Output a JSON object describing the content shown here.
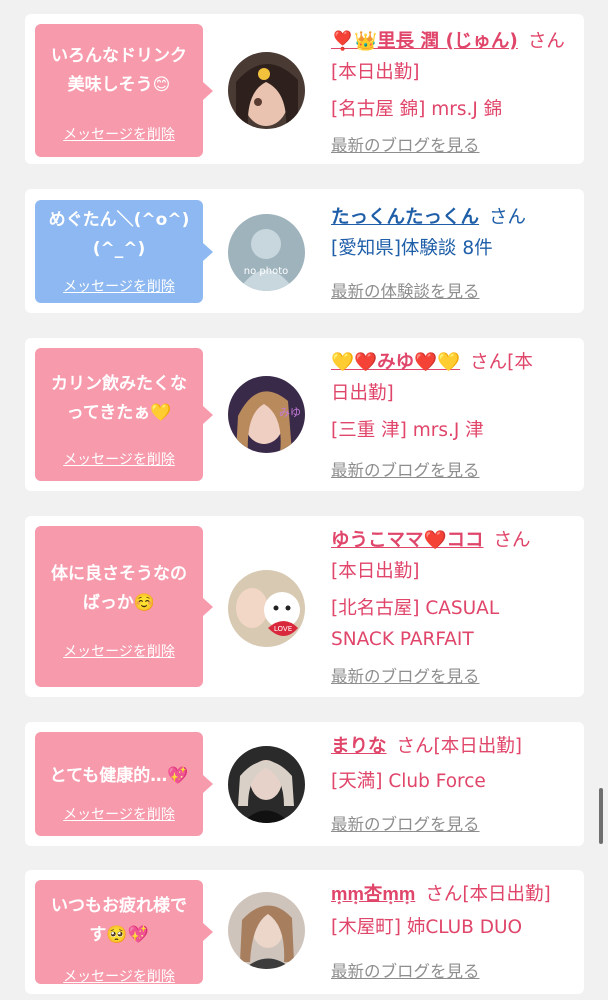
{
  "delete_label": "メッセージを削除",
  "cards": [
    {
      "message": "いろんなドリンク\n美味しそう😊",
      "name": "❣️👑里長 潤 (じゅん)",
      "san": "さん",
      "lines": [
        "[本日出勤]",
        "[名古屋 錦] mrs.J 錦"
      ],
      "link": "最新のブログを見る"
    },
    {
      "message": "めぐたん＼(^o^)\n(^_^)",
      "name": "たっくんたっくん",
      "san": "さん",
      "lines": [
        "[愛知県]体験談 8件"
      ],
      "link": "最新の体験談を見る",
      "avatar_text": "no photo"
    },
    {
      "message": "カリン飲みたくな\nってきたぁ💛",
      "name": "💛❤️みゆ❤️💛",
      "san": "さん[本",
      "lines": [
        "日出勤]",
        "[三重 津] mrs.J 津"
      ],
      "link": "最新のブログを見る",
      "avatar_text": "みゆ"
    },
    {
      "message": "体に良さそうなの\nばっか☺️",
      "name": "ゆうこママ❤️ココ",
      "san": "さん",
      "lines": [
        "[本日出勤]",
        "[北名古屋] CASUAL",
        "SNACK PARFAIT"
      ],
      "link": "最新のブログを見る",
      "avatar_text": "LOVE"
    },
    {
      "message": "とても健康的…💖",
      "name": "まりな",
      "san": "さん[本日出勤]",
      "lines": [
        "[天満] Club Force"
      ],
      "link": "最新のブログを見る"
    },
    {
      "message": "いつもお疲れ様で\nす🥺💖",
      "name": "m͙m͙杏m͙m͙",
      "san": "さん[本日出勤]",
      "lines": [
        "[木屋町] 姉CLUB DUO"
      ],
      "link": "最新のブログを見る"
    }
  ],
  "colors": {
    "pink_bubble": "#f79aac",
    "blue_bubble": "#8db8f1",
    "pink_text": "#e0456a",
    "blue_text": "#1f5ea8",
    "link_gray": "#8e8e8e",
    "background": "#f1f1f1"
  }
}
